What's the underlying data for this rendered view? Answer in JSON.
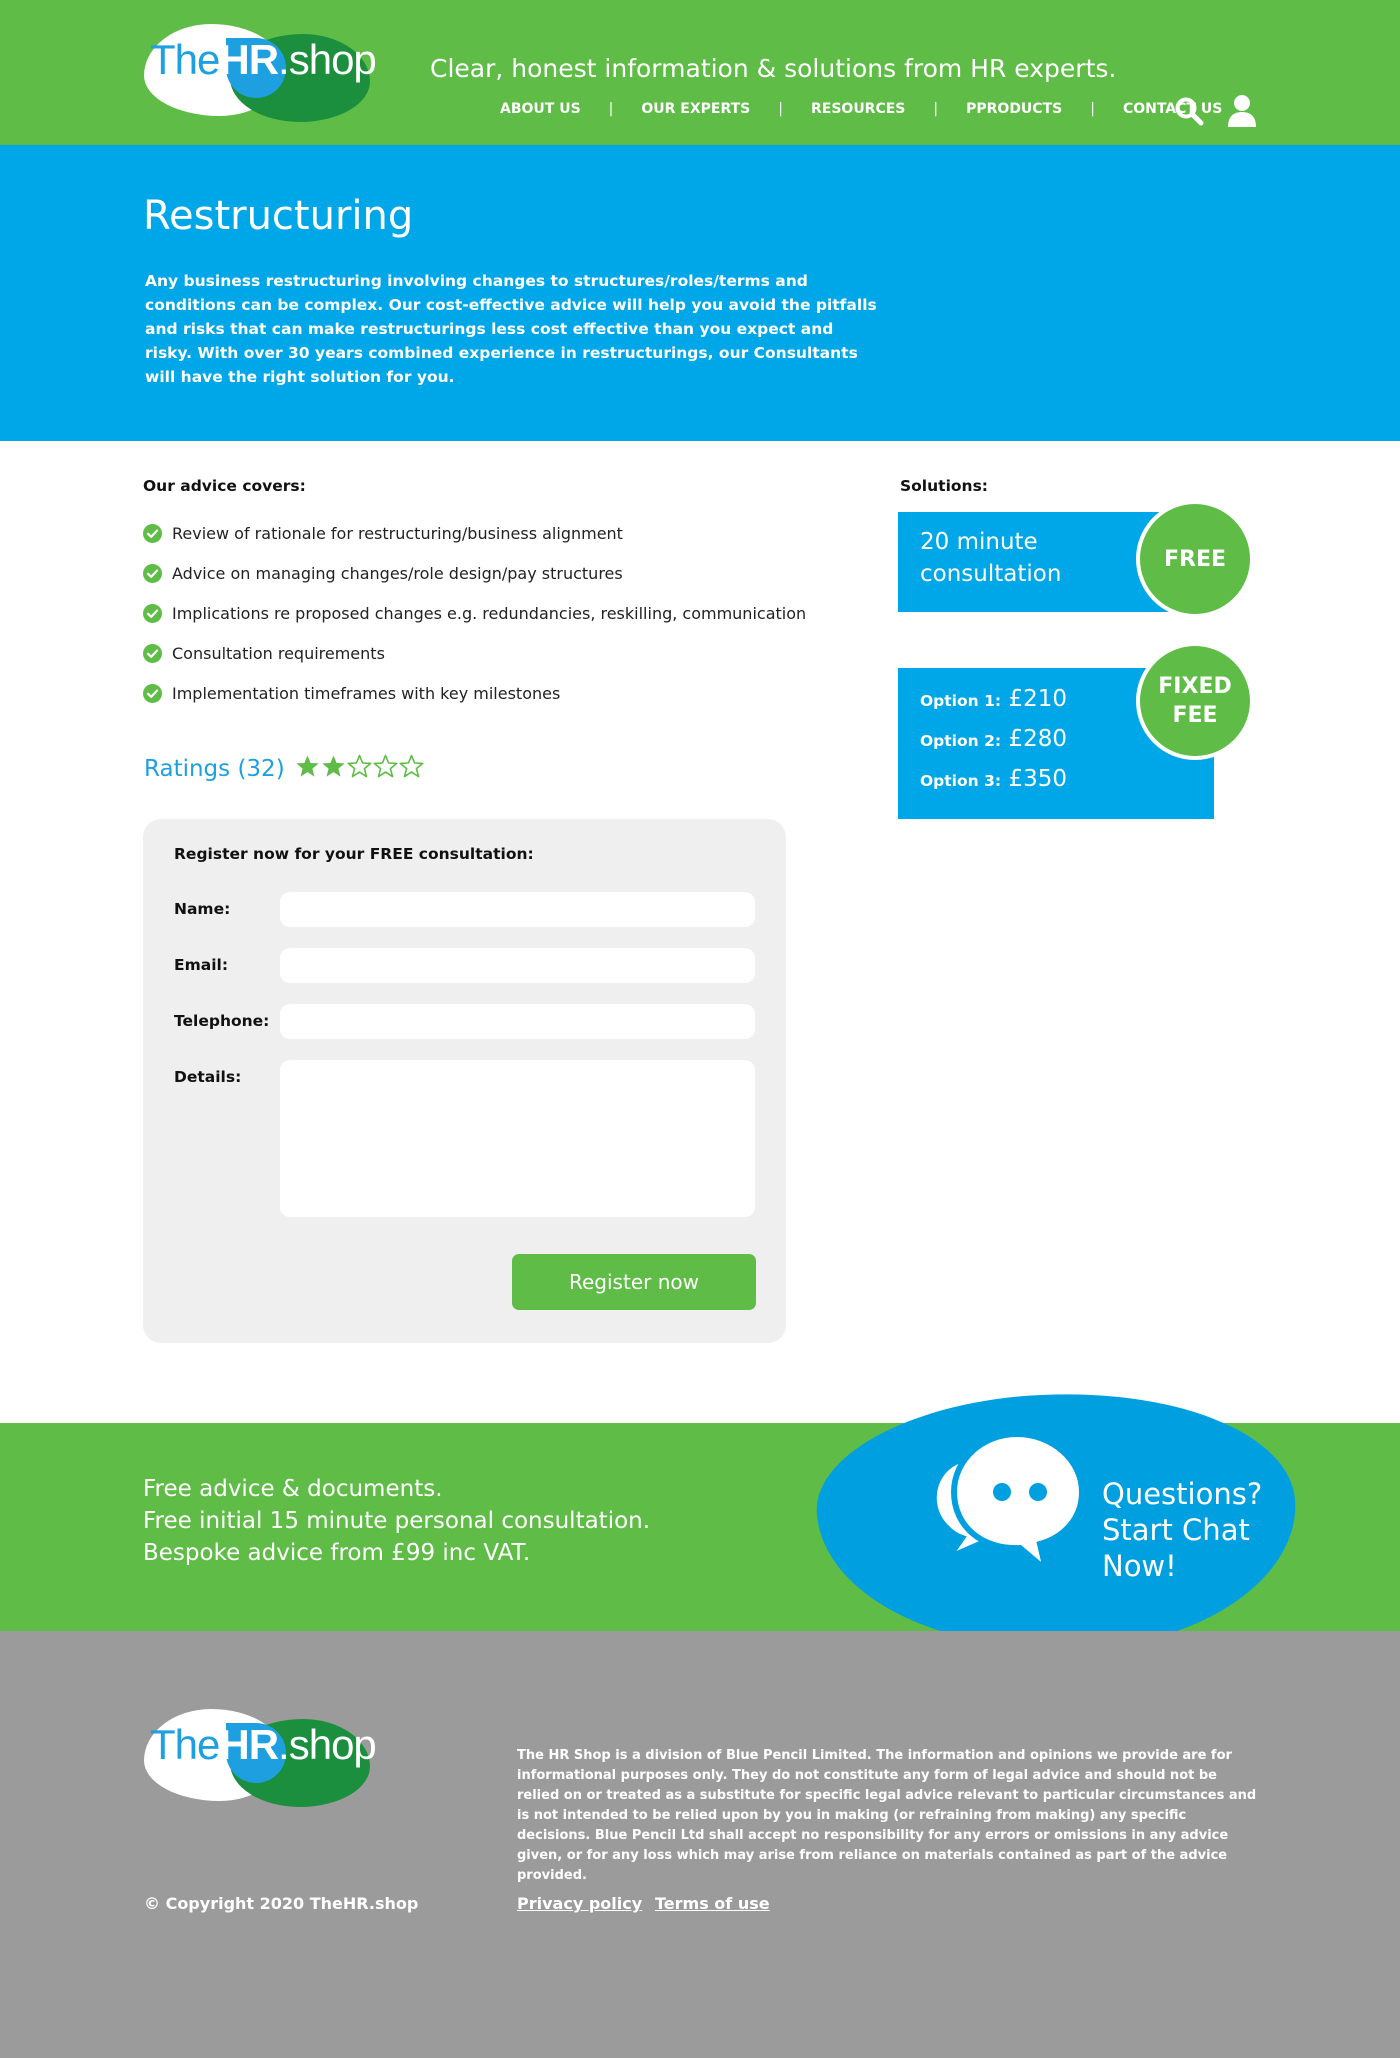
{
  "brand": {
    "logo_the": "The",
    "logo_hr": "HR",
    "logo_shop": ".shop",
    "tagline": "Clear, honest information & solutions from HR experts.",
    "colors": {
      "green": "#5fbd47",
      "blue": "#00a7e8",
      "dark_green": "#1b8f3d",
      "grey": "#9b9b9b"
    }
  },
  "nav": {
    "items": [
      {
        "label": "ABOUT US"
      },
      {
        "label": "OUR EXPERTS"
      },
      {
        "label": "RESOURCES"
      },
      {
        "label": "PPRODUCTS"
      },
      {
        "label": "CONTACT US"
      }
    ],
    "separator": "|",
    "icons": [
      "search-icon",
      "user-icon"
    ]
  },
  "hero": {
    "title": "Restructuring",
    "description": "Any business restructuring involving changes to structures/roles/terms and conditions can be complex. Our cost-effective advice will help you avoid the pitfalls and risks that can make restructurings less cost effective than you expect and risky. With over 30 years combined experience in restructurings, our Consultants will have the right solution for you."
  },
  "covers": {
    "title": "Our advice covers:",
    "items": [
      "Review of rationale for restructuring/business alignment",
      "Advice on managing changes/role design/pay structures",
      "Implications re proposed changes e.g. redundancies, reskilling, communication",
      "Consultation requirements",
      "Implementation timeframes with key milestones"
    ]
  },
  "ratings": {
    "label": "Ratings (32)",
    "stars_filled": 2,
    "stars_total": 5
  },
  "form": {
    "title": "Register now for your FREE consultation:",
    "name_label": "Name:",
    "email_label": "Email:",
    "telephone_label": "Telephone:",
    "details_label": "Details:",
    "name_value": "",
    "email_value": "",
    "telephone_value": "",
    "details_value": "",
    "submit_label": "Register now"
  },
  "solutions": {
    "title": "Solutions:",
    "consultation_line1": "20 minute",
    "consultation_line2": "consultation",
    "free_badge": "FREE",
    "fixed_badge_line1": "FIXED",
    "fixed_badge_line2": "FEE",
    "options": [
      {
        "label": "Option 1:",
        "price": "£210"
      },
      {
        "label": "Option 2:",
        "price": "£280"
      },
      {
        "label": "Option 3:",
        "price": "£350"
      }
    ]
  },
  "band": {
    "lines": [
      "Free advice & documents.",
      "Free initial 15 minute personal consultation.",
      "Bespoke advice from £99 inc VAT."
    ],
    "chat_lines": [
      "Questions?",
      "Start Chat",
      "Now!"
    ]
  },
  "footer": {
    "legal": "The HR Shop is a division of Blue Pencil Limited. The information and opinions we provide are for informational purposes only. They do not constitute any form of legal advice and should not be relied on or treated as a substitute for specific legal advice relevant to particular circumstances and is not intended to be relied upon by you in making (or refraining from making) any specific decisions. Blue Pencil Ltd shall accept no responsibility for any errors or omissions in any advice given, or for any loss which may arise from reliance on materials contained as part of the advice provided.",
    "copyright": "© Copyright 2020 TheHR.shop",
    "privacy": "Privacy policy",
    "terms": "Terms of use"
  }
}
